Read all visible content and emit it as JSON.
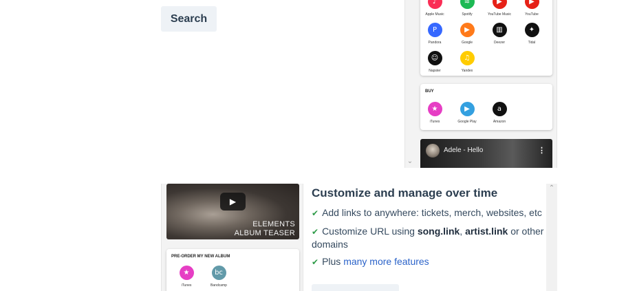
{
  "search": {
    "label": "Search"
  },
  "listen_card": {
    "services": [
      {
        "name": "Apple Music",
        "icon": "apple-music-icon",
        "color": "#fa2d55",
        "glyph": "♪"
      },
      {
        "name": "Spotify",
        "icon": "spotify-icon",
        "color": "#1db954",
        "glyph": "≋"
      },
      {
        "name": "YouTube Music",
        "icon": "youtube-music-icon",
        "color": "#e62117",
        "glyph": "▶"
      },
      {
        "name": "YouTube",
        "icon": "youtube-icon",
        "color": "#e62117",
        "glyph": "▶"
      },
      {
        "name": "Pandora",
        "icon": "pandora-icon",
        "color": "#3668ff",
        "glyph": "P"
      },
      {
        "name": "Google",
        "icon": "google-play-music-icon",
        "color": "#ff7a1a",
        "glyph": "▶"
      },
      {
        "name": "Deezer",
        "icon": "deezer-icon",
        "color": "#111111",
        "glyph": "▥"
      },
      {
        "name": "Tidal",
        "icon": "tidal-icon",
        "color": "#111111",
        "glyph": "✦"
      },
      {
        "name": "Napster",
        "icon": "napster-icon",
        "color": "#111111",
        "glyph": "☺"
      },
      {
        "name": "Yandex",
        "icon": "yandex-music-icon",
        "color": "#ffcc00",
        "glyph": "♫"
      }
    ]
  },
  "buy_card": {
    "title": "BUY",
    "services": [
      {
        "name": "iTunes",
        "icon": "itunes-icon",
        "color": "#e63ec4",
        "glyph": "★"
      },
      {
        "name": "Google Play",
        "icon": "google-play-icon",
        "color": "#34a0e0",
        "glyph": "▶"
      },
      {
        "name": "Amazon",
        "icon": "amazon-icon",
        "color": "#111111",
        "glyph": "a"
      }
    ]
  },
  "video": {
    "title": "Adele - Hello",
    "menu_glyph": "⋮"
  },
  "album": {
    "teaser_line1": "ELEMENTS",
    "teaser_line2": "ALBUM TEASER",
    "preorder_title": "PRE-ORDER MY NEW ALBUM",
    "services": [
      {
        "name": "iTunes",
        "icon": "itunes-icon",
        "color": "#e63ec4",
        "glyph": "★"
      },
      {
        "name": "Bandcamp",
        "icon": "bandcamp-icon",
        "color": "#629aa9",
        "glyph": "bc"
      }
    ]
  },
  "features": {
    "title": "Customize and manage over time",
    "item1": "Add links to anywhere: tickets, merch, websites, etc",
    "item2_pre": "Customize URL using ",
    "item2_song": "song.link",
    "item2_sep": ", ",
    "item2_artist": "artist.link",
    "item2_post": " or other domains",
    "item3_pre": "Plus ",
    "item3_link": "many more features"
  }
}
